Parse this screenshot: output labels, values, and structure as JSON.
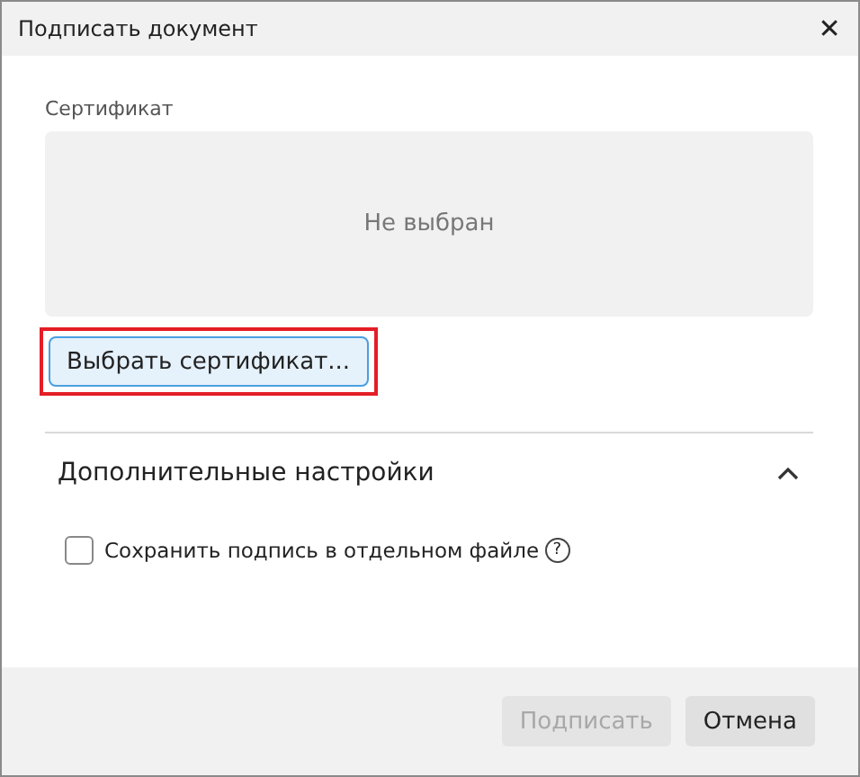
{
  "window": {
    "title": "Подписать документ",
    "close": "✕"
  },
  "certificate": {
    "label": "Сертификат",
    "value": "Не выбран",
    "choose_button": {
      "label": "Выбрать сертификат...",
      "highlighted": true
    }
  },
  "advanced": {
    "title": "Дополнительные настройки",
    "expanded": true,
    "options": [
      {
        "label": "Сохранить подпись в отдельном файле",
        "checked": false,
        "help": "?"
      }
    ]
  },
  "buttons": [
    {
      "label": "Подписать",
      "disabled": true
    },
    {
      "label": "Отмена",
      "disabled": false
    }
  ]
}
